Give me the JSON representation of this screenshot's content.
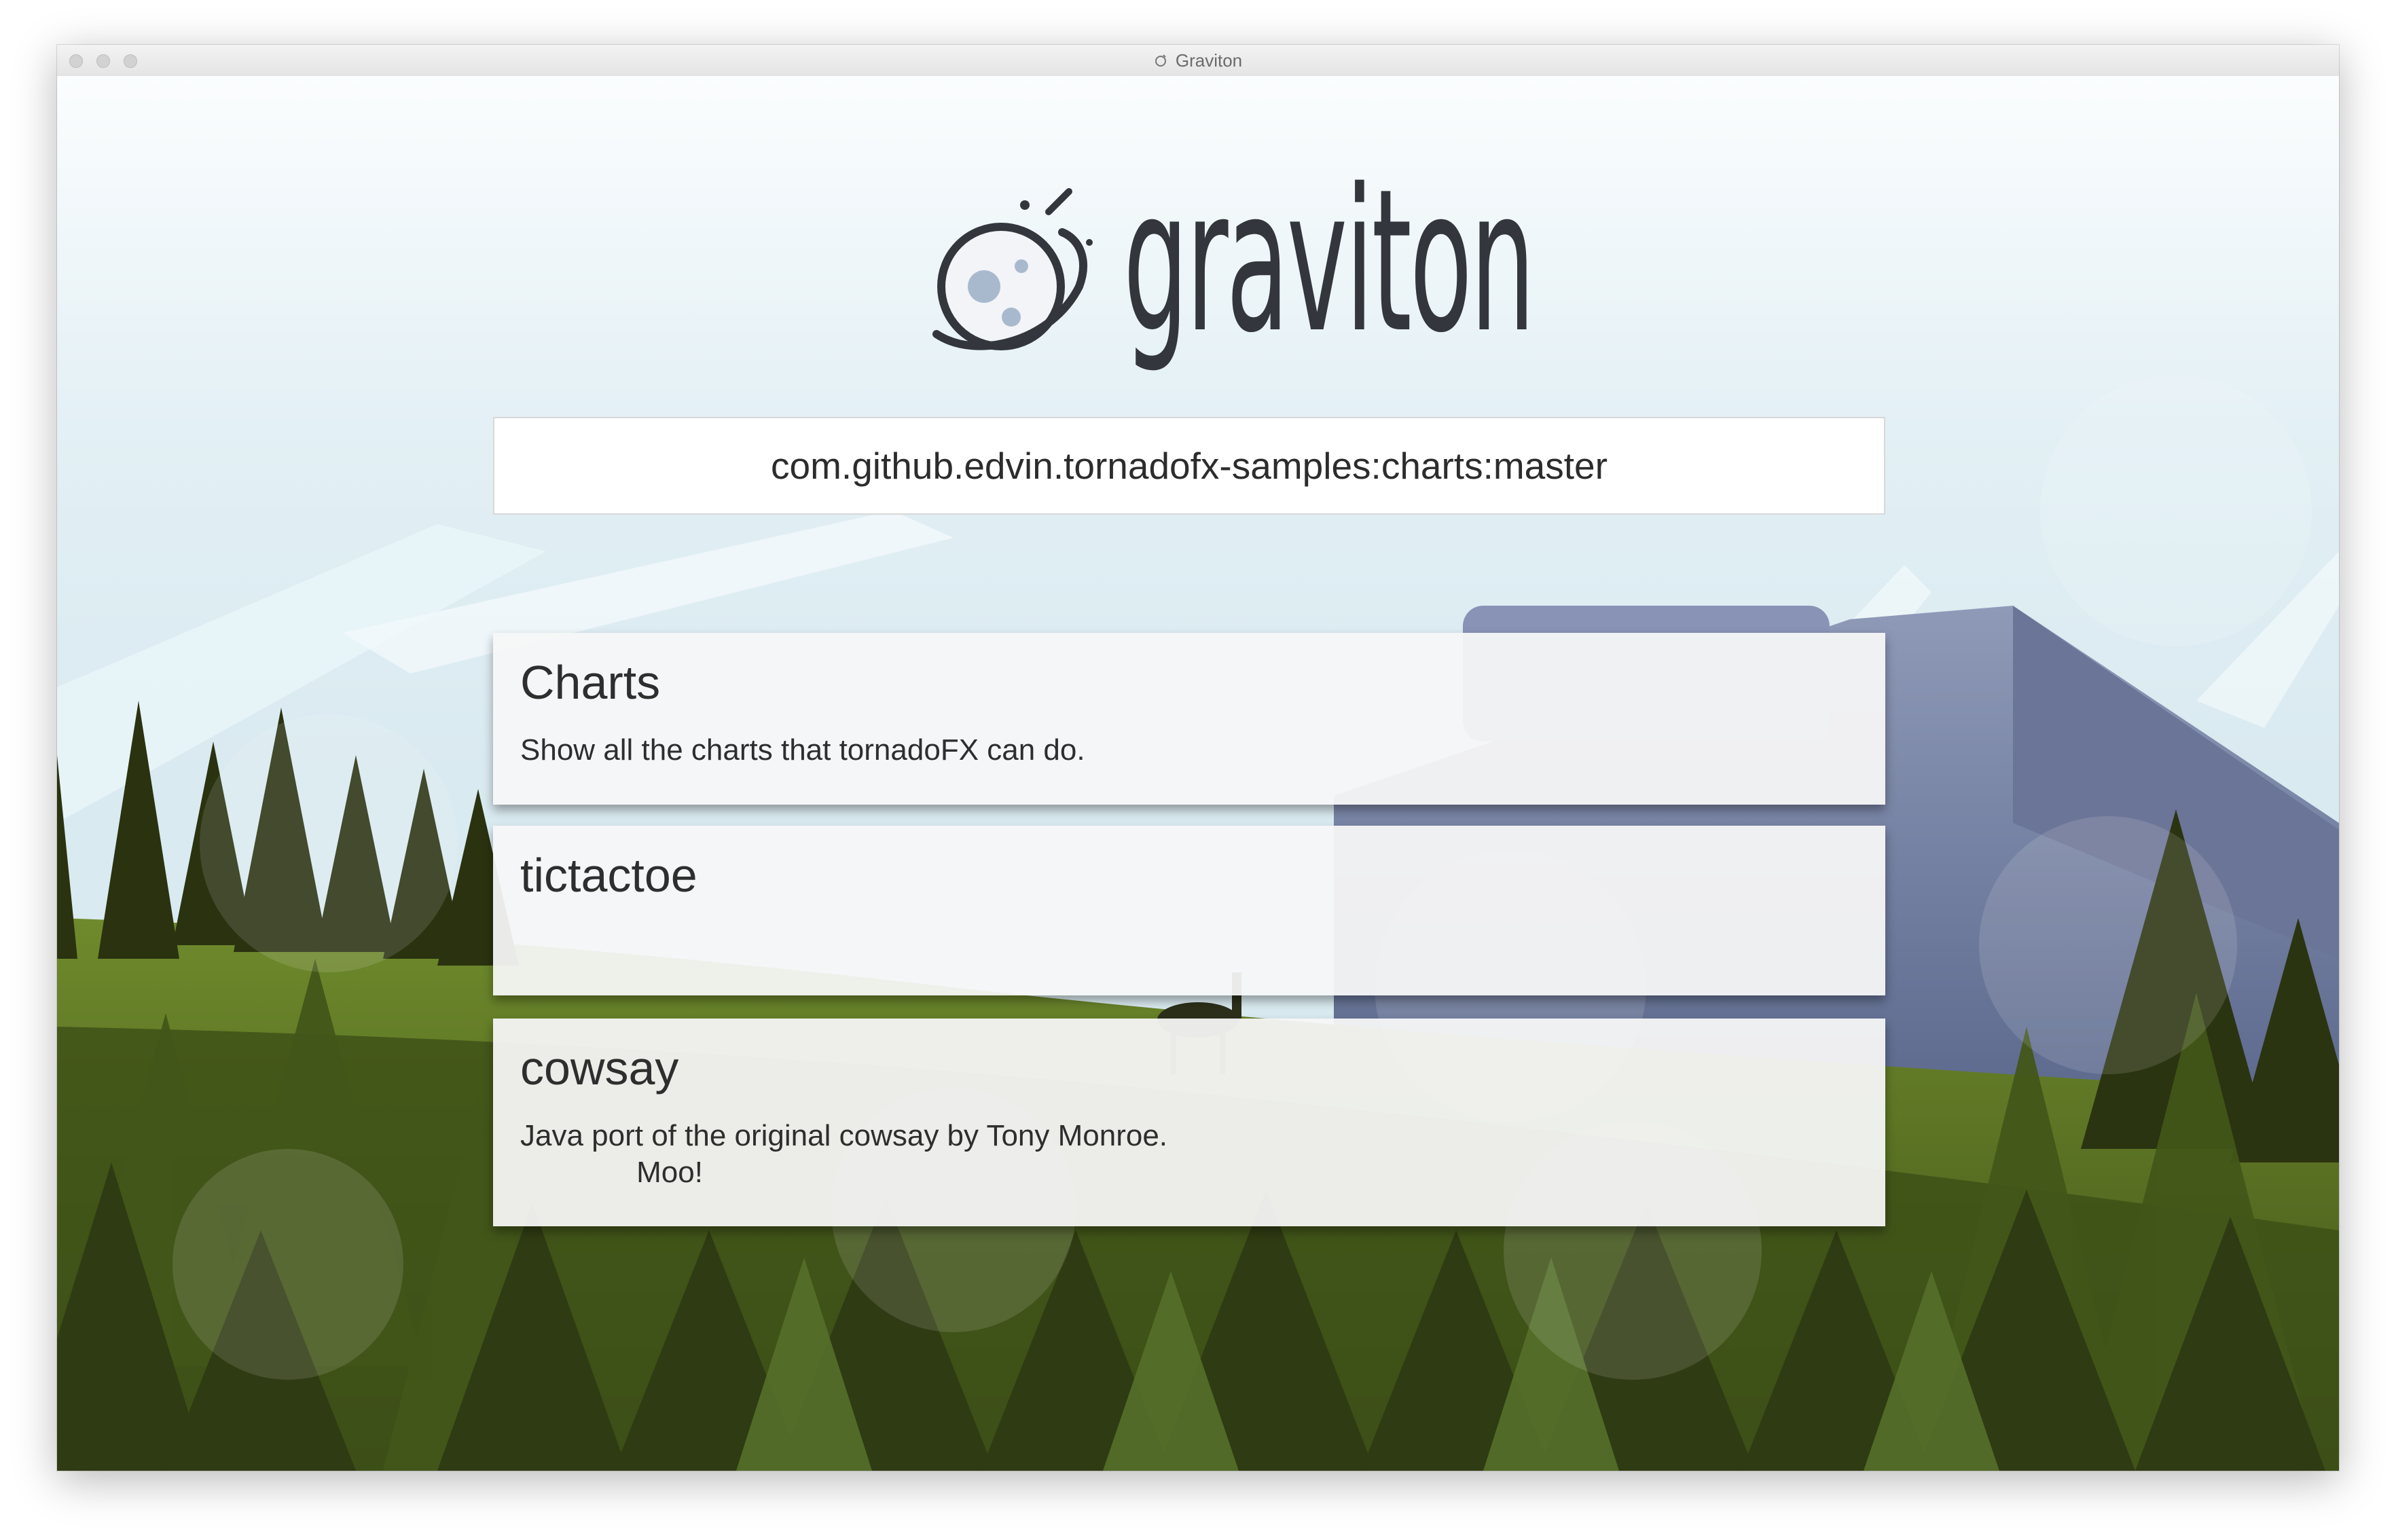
{
  "window": {
    "title": "Graviton",
    "title_icon": "graviton-planet-icon"
  },
  "logo": {
    "text": "graviton",
    "icon": "planet-ring-icon"
  },
  "search": {
    "value": "com.github.edvin.tornadofx-samples:charts:master"
  },
  "apps": [
    {
      "title": "Charts",
      "description": "Show all the charts that tornadoFX can do."
    },
    {
      "title": "tictactoe",
      "description": ""
    },
    {
      "title": "cowsay",
      "description": "Java port of the original cowsay by Tony Monroe.\n              Moo!"
    }
  ],
  "colors": {
    "sky": "#dcecf2",
    "forest_dark": "#2f3a12",
    "forest_mid": "#4d5e1f",
    "mountain": "#8b95b7",
    "card_bg": "#f4f4f4"
  }
}
